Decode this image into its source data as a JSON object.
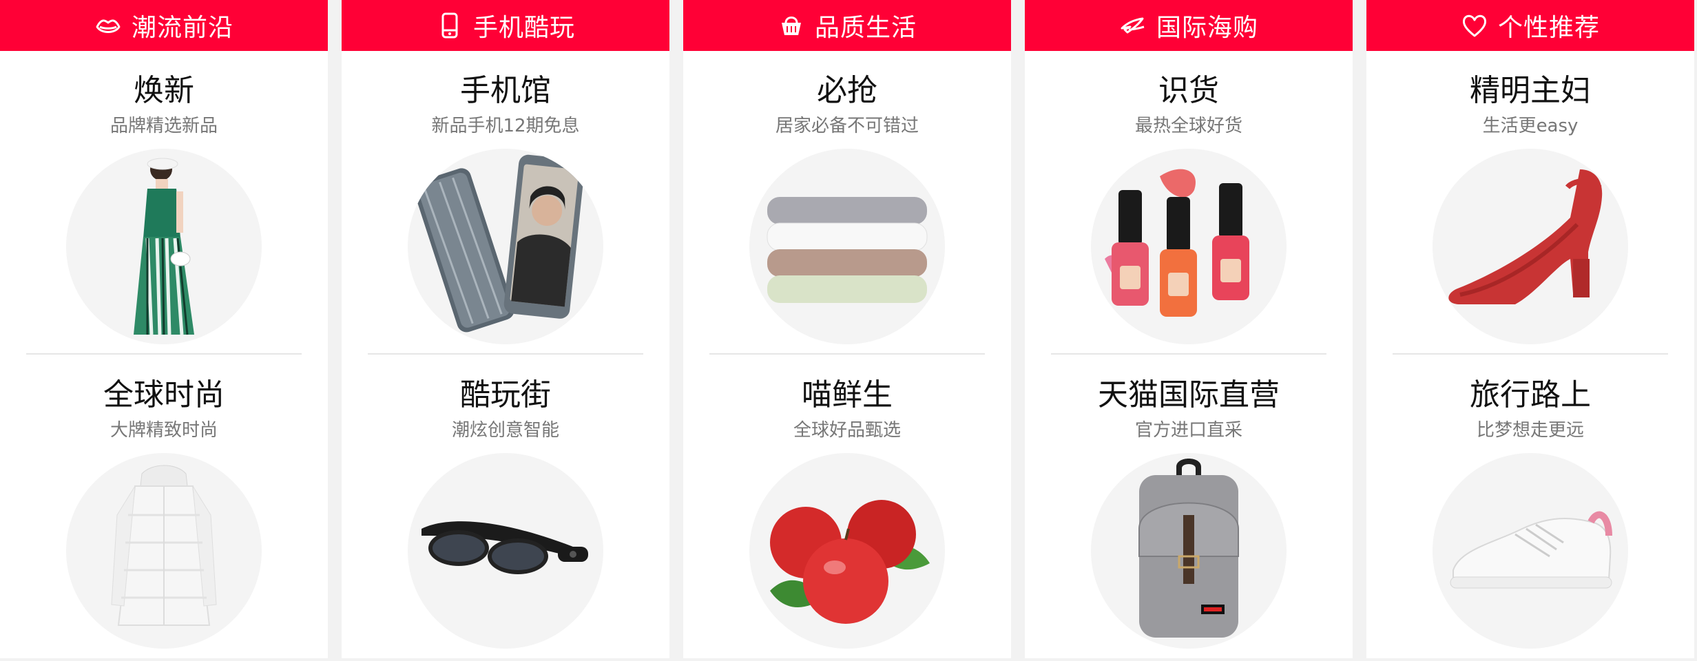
{
  "theme": {
    "accent": "#ff0036"
  },
  "columns": [
    {
      "header": {
        "label": "潮流前沿",
        "icon": "lips-icon"
      },
      "top": {
        "title": "焕新",
        "subtitle": "品牌精选新品",
        "image": "fashion-model-image"
      },
      "bottom": {
        "title": "全球时尚",
        "subtitle": "大牌精致时尚",
        "image": "white-down-coat-image"
      }
    },
    {
      "header": {
        "label": "手机酷玩",
        "icon": "phone-icon"
      },
      "top": {
        "title": "手机馆",
        "subtitle": "新品手机12期免息",
        "image": "smartphone-image"
      },
      "bottom": {
        "title": "酷玩街",
        "subtitle": "潮炫创意智能",
        "image": "smart-glasses-image"
      }
    },
    {
      "header": {
        "label": "品质生活",
        "icon": "basket-icon"
      },
      "top": {
        "title": "必抢",
        "subtitle": "居家必备不可错过",
        "image": "towel-stack-image"
      },
      "bottom": {
        "title": "喵鲜生",
        "subtitle": "全球好品甄选",
        "image": "apples-image"
      }
    },
    {
      "header": {
        "label": "国际海购",
        "icon": "plane-icon"
      },
      "top": {
        "title": "识货",
        "subtitle": "最热全球好货",
        "image": "nail-polish-image"
      },
      "bottom": {
        "title": "天猫国际直营",
        "subtitle": "官方进口直采",
        "image": "backpack-image"
      }
    },
    {
      "header": {
        "label": "个性推荐",
        "icon": "heart-icon"
      },
      "top": {
        "title": "精明主妇",
        "subtitle": "生活更easy",
        "image": "red-sandal-image"
      },
      "bottom": {
        "title": "旅行路上",
        "subtitle": "比梦想走更远",
        "image": "white-sneaker-image"
      }
    }
  ]
}
